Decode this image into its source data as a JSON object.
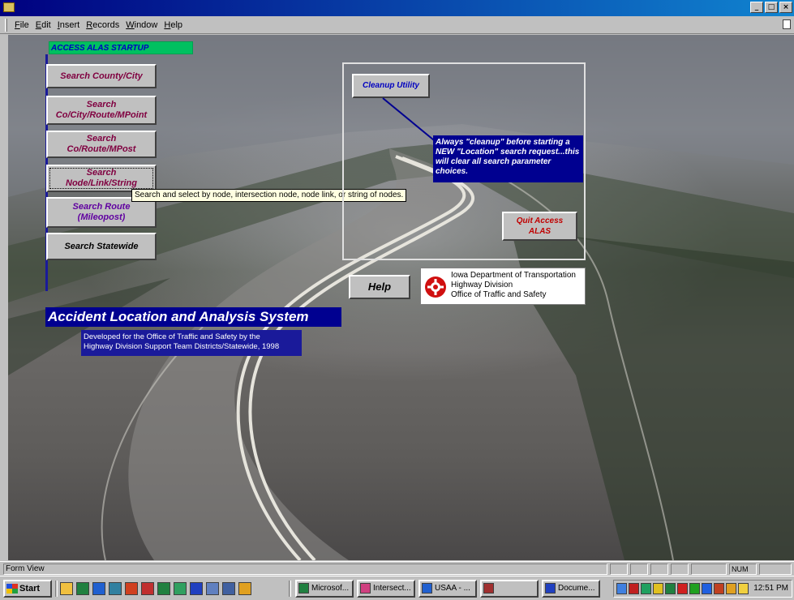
{
  "menu": {
    "items": [
      "File",
      "Edit",
      "Insert",
      "Records",
      "Window",
      "Help"
    ]
  },
  "window_controls": {
    "minimize": "_",
    "maximize": "□",
    "close": "×"
  },
  "form": {
    "startup_label": "ACCESS ALAS STARTUP",
    "buttons": {
      "search_county_city": "Search County/City",
      "search_co_city_route_mpoint": [
        "Search",
        "Co/City/Route/MPoint"
      ],
      "search_co_route_mpost": [
        "Search",
        "Co/Route/MPost"
      ],
      "search_node_link_string": [
        "Search",
        "Node/Link/String"
      ],
      "search_route_mileopost": [
        "Search  Route",
        "(Mileopost)"
      ],
      "search_statewide": "Search  Statewide",
      "cleanup_utility": "Cleanup Utility",
      "quit_access_alas": [
        "Quit Access",
        "ALAS"
      ],
      "help": "Help"
    },
    "tooltip": "Search and select by node, intersection node, node link, or string of nodes.",
    "cleanup_note": "Always \"cleanup\" before starting a NEW \"Location\" search request...this will clear all search parameter choices.",
    "agency": {
      "line1": "Iowa Department of Transportation",
      "line2": "Highway Division",
      "line3": "Office of Traffic and Safety"
    },
    "title": "Accident Location and Analysis System",
    "subtitle_lines": [
      "Developed for the Office of Traffic and Safety by the",
      "Highway Division Support Team Districts/Statewide, 1998"
    ]
  },
  "status": {
    "text": "Form View",
    "num": "NUM"
  },
  "taskbar": {
    "start": "Start",
    "tasks": [
      "Microsof...",
      "Intersect...",
      "USAA - ...",
      "",
      "Docume..."
    ],
    "clock": "12:51 PM"
  },
  "colors": {
    "title_bar": "#000080",
    "label_green": "#00c060",
    "button_text_maroon": "#800040",
    "note_navy": "#000090",
    "quit_red": "#c00000"
  }
}
